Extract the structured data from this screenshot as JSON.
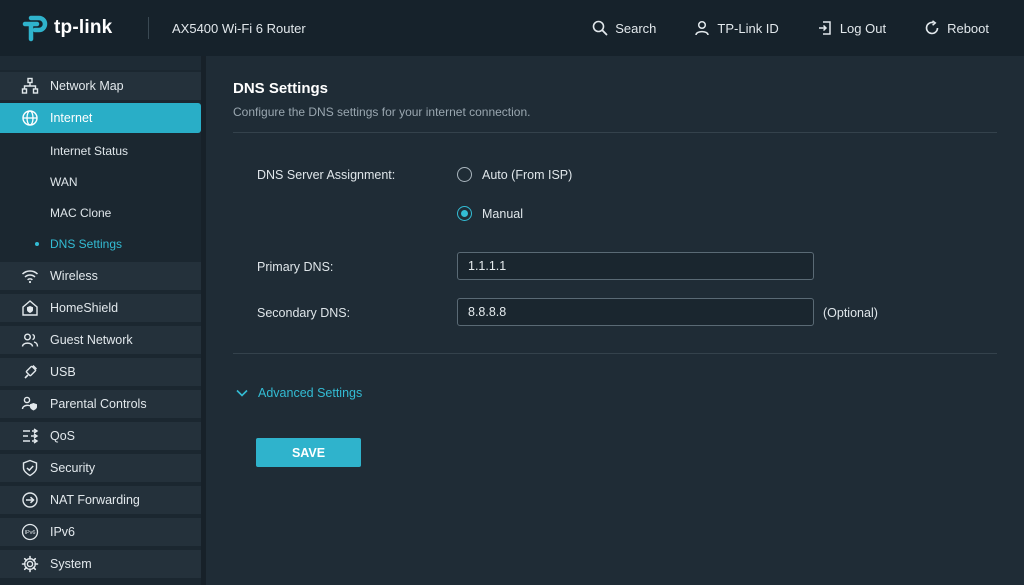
{
  "header": {
    "brand": "tp-link",
    "model": "AX5400 Wi-Fi 6 Router",
    "actions": [
      {
        "label": "Search",
        "icon": "search-icon"
      },
      {
        "label": "TP-Link ID",
        "icon": "user-icon"
      },
      {
        "label": "Log Out",
        "icon": "logout-icon"
      },
      {
        "label": "Reboot",
        "icon": "reboot-icon"
      }
    ]
  },
  "sidebar": {
    "items": [
      {
        "label": "Network Map",
        "icon": "network-map-icon"
      },
      {
        "label": "Internet",
        "icon": "globe-icon",
        "active": true
      },
      {
        "label": "Wireless",
        "icon": "wifi-icon"
      },
      {
        "label": "HomeShield",
        "icon": "home-shield-icon"
      },
      {
        "label": "Guest Network",
        "icon": "users-icon"
      },
      {
        "label": "USB",
        "icon": "usb-icon"
      },
      {
        "label": "Parental Controls",
        "icon": "parental-controls-icon"
      },
      {
        "label": "QoS",
        "icon": "qos-icon"
      },
      {
        "label": "Security",
        "icon": "security-shield-icon"
      },
      {
        "label": "NAT Forwarding",
        "icon": "nat-forwarding-icon"
      },
      {
        "label": "IPv6",
        "icon": "ipv6-icon"
      },
      {
        "label": "System",
        "icon": "gear-icon"
      }
    ],
    "internet_sub": [
      "Internet Status",
      "WAN",
      "MAC Clone",
      "DNS Settings"
    ],
    "current_sub": "DNS Settings"
  },
  "main": {
    "title": "DNS Settings",
    "description": "Configure the DNS settings for your internet connection.",
    "assignment_label": "DNS Server Assignment:",
    "option_auto": "Auto (From ISP)",
    "option_manual": "Manual",
    "selected": "Manual",
    "primary_label": "Primary DNS:",
    "primary_value": "1.1.1.1",
    "secondary_label": "Secondary DNS:",
    "secondary_value": "8.8.8.8",
    "optional_text": "(Optional)",
    "advanced_label": "Advanced Settings",
    "save_label": "SAVE"
  },
  "colors": {
    "accent": "#2fb3cc",
    "background": "#1f2c36",
    "header": "#16222b"
  }
}
